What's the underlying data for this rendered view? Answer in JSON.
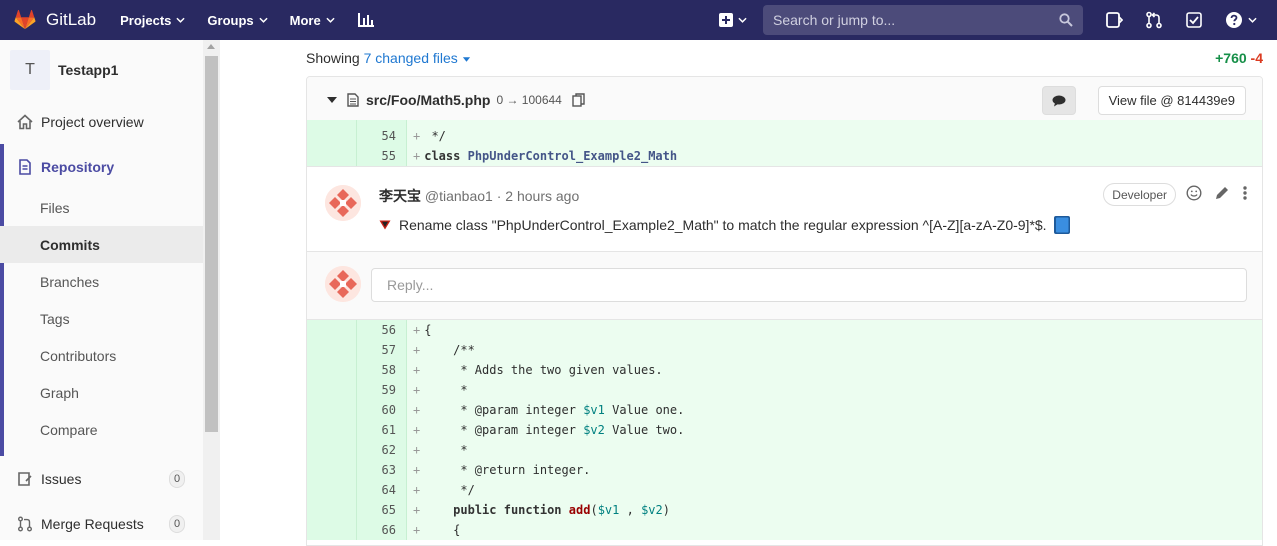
{
  "navbar": {
    "brand": "GitLab",
    "menu": [
      {
        "label": "Projects"
      },
      {
        "label": "Groups"
      },
      {
        "label": "More"
      }
    ],
    "search_placeholder": "Search or jump to...",
    "icons": [
      "plus-square-icon",
      "todo-icon",
      "merge-request-icon",
      "issues-check-icon",
      "help-icon"
    ]
  },
  "sidebar": {
    "project_initial": "T",
    "project_name": "Testapp1",
    "overview": "Project overview",
    "repository": "Repository",
    "repo_items": [
      "Files",
      "Commits",
      "Branches",
      "Tags",
      "Contributors",
      "Graph",
      "Compare"
    ],
    "active_item": "Commits",
    "issues": {
      "label": "Issues",
      "count": "0"
    },
    "merge_requests": {
      "label": "Merge Requests",
      "count": "0"
    }
  },
  "main": {
    "showing_prefix": "Showing",
    "changed_files": "7 changed files",
    "additions": "+760",
    "deletions": "-4",
    "file": {
      "path": "src/Foo/Math5.php",
      "mode": "0 → 100644",
      "view_file": "View file @ 814439e9"
    },
    "lines_top": [
      {
        "num": "54",
        "code": " */"
      },
      {
        "num": "55",
        "code": "class PhpUnderControl_Example2_Math"
      }
    ],
    "note": {
      "author": "李天宝",
      "handle": "@tianbao1",
      "time": "2 hours ago",
      "role": "Developer",
      "body": "Rename class \"PhpUnderControl_Example2_Math\" to match the regular expression ^[A-Z][a-zA-Z0-9]*$."
    },
    "reply_placeholder": "Reply...",
    "lines_bottom": [
      {
        "num": "56",
        "code": "{"
      },
      {
        "num": "57",
        "code": "    /**"
      },
      {
        "num": "58",
        "code": "     * Adds the two given values."
      },
      {
        "num": "59",
        "code": "     *"
      },
      {
        "num": "60",
        "code": "     * @param integer $v1 Value one."
      },
      {
        "num": "61",
        "code": "     * @param integer $v2 Value two."
      },
      {
        "num": "62",
        "code": "     *"
      },
      {
        "num": "63",
        "code": "     * @return integer."
      },
      {
        "num": "64",
        "code": "     */"
      },
      {
        "num": "65",
        "code": "    public function add($v1 , $v2)"
      },
      {
        "num": "66",
        "code": "    {"
      }
    ]
  }
}
